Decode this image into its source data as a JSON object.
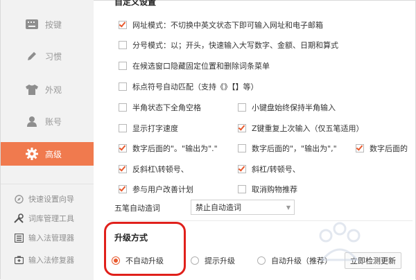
{
  "sidebar": {
    "items": [
      {
        "label": "按键",
        "icon": "keyboard-icon"
      },
      {
        "label": "习惯",
        "icon": "pencil-icon"
      },
      {
        "label": "外观",
        "icon": "tshirt-icon"
      },
      {
        "label": "账号",
        "icon": "user-icon"
      },
      {
        "label": "高级",
        "icon": "gear-icon",
        "active": true
      }
    ],
    "tools": [
      {
        "label": "快速设置向导",
        "icon": "compass-icon"
      },
      {
        "label": "词库管理工具",
        "icon": "tools-icon"
      },
      {
        "label": "输入法管理器",
        "icon": "list-icon"
      },
      {
        "label": "输入法修复器",
        "icon": "repair-icon"
      }
    ]
  },
  "main": {
    "section_title": "自定义设置",
    "options": [
      {
        "label": "网址模式：不切换中英文状态下即可输入网址和电子邮箱",
        "checked": true
      },
      {
        "label": "分号模式：以；开头，快速输入大写数字、金额、日期和算式",
        "checked": false
      },
      {
        "label": "在候选窗口隐藏固定位置和删除词条菜单",
        "checked": false
      },
      {
        "label": "标点符号自动匹配（支持《》【】等）",
        "checked": false
      },
      {
        "label": "半角状态下全角空格",
        "checked": false
      },
      {
        "label": "小键盘始终保持半角输入",
        "checked": false
      },
      {
        "label": "显示打字速度",
        "checked": false
      },
      {
        "label": "Z键重复上次输入（仅五笔适用）",
        "checked": true
      },
      {
        "label": "数字后面的\"。\"输出为\".\"",
        "checked": true
      },
      {
        "label": "数字后面的\"，\"输出为\",\"",
        "checked": false
      },
      {
        "label": "数字后面的",
        "checked": true
      },
      {
        "label": "反斜杠\\转顿号、",
        "checked": true
      },
      {
        "label": "斜杠/转顿号、",
        "checked": true
      },
      {
        "label": "参与用户改善计划",
        "checked": true
      },
      {
        "label": "取消购物推荐",
        "checked": false
      }
    ],
    "wubi_label": "五笔自动造词",
    "wubi_value": "禁止自动造词",
    "upgrade_title": "升级方式",
    "upgrade_options": [
      {
        "label": "不自动升级",
        "selected": true
      },
      {
        "label": "提示升级",
        "selected": false
      },
      {
        "label": "自动升级（推荐）",
        "selected": false
      }
    ],
    "check_update_button": "立即检测更新"
  },
  "colors": {
    "accent": "#f07a4e",
    "check": "#e8592d",
    "highlight_ring": "#e0201b"
  }
}
